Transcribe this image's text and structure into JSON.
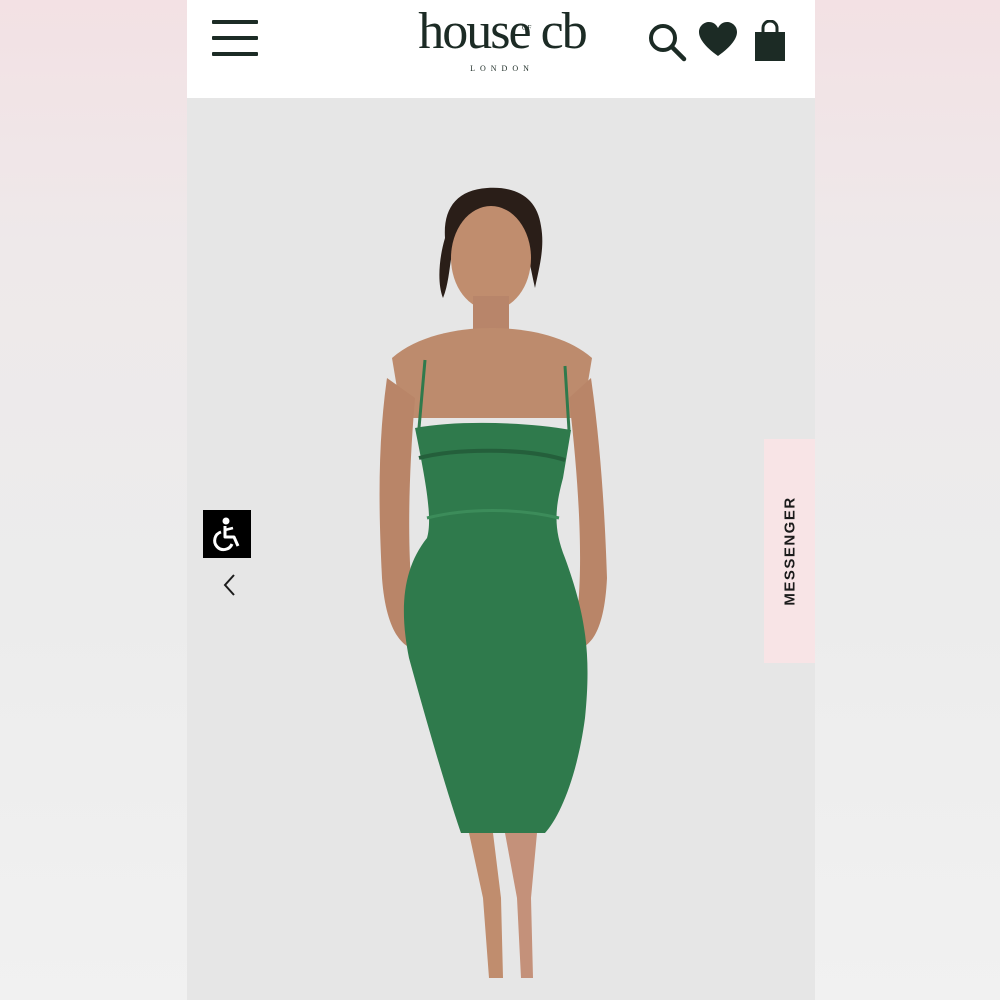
{
  "header": {
    "brand_word": "house cb",
    "brand_of": "OF",
    "brand_city": "LONDON",
    "icons": [
      "menu-icon",
      "search-icon",
      "heart-icon",
      "shopping-bag-icon"
    ]
  },
  "hero": {
    "product_color": "#2f7a4c",
    "background_color": "#e6e6e6",
    "arrow_icon": "chevron-left-icon"
  },
  "accessibility": {
    "icon": "accessibility-icon"
  },
  "messenger": {
    "label": "MESSENGER",
    "background": "#f8e4e6"
  },
  "colors": {
    "brand": "#1c2b25",
    "page_bg_top": "#f3e1e4",
    "header_bg": "#ffffff"
  }
}
